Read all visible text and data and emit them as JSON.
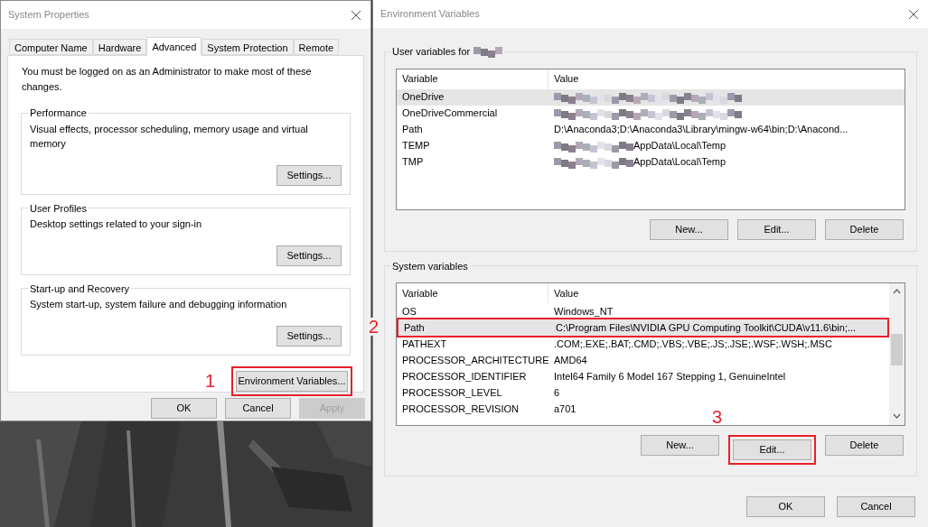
{
  "system_properties": {
    "title": "System Properties",
    "tabs": [
      {
        "label": "Computer Name",
        "selected": false
      },
      {
        "label": "Hardware",
        "selected": false
      },
      {
        "label": "Advanced",
        "selected": true
      },
      {
        "label": "System Protection",
        "selected": false
      },
      {
        "label": "Remote",
        "selected": false
      }
    ],
    "notice": "You must be logged on as an Administrator to make most of these changes.",
    "groups": [
      {
        "title": "Performance",
        "description": "Visual effects, processor scheduling, memory usage and virtual memory",
        "button": "Settings..."
      },
      {
        "title": "User Profiles",
        "description": "Desktop settings related to your sign-in",
        "button": "Settings..."
      },
      {
        "title": "Start-up and Recovery",
        "description": "System start-up, system failure and debugging information",
        "button": "Settings..."
      }
    ],
    "env_button": {
      "label": "Environment Variables...",
      "annotation": "1"
    },
    "buttons": [
      {
        "label": "OK",
        "disabled": false
      },
      {
        "label": "Cancel",
        "disabled": false
      },
      {
        "label": "Apply",
        "disabled": true
      }
    ]
  },
  "environment_variables": {
    "title": "Environment Variables",
    "user_group": {
      "title": "User variables for",
      "name_redacted": true,
      "columns": [
        "Variable",
        "Value"
      ],
      "rows": [
        {
          "variable": "OneDrive",
          "redacted": true,
          "selected": true
        },
        {
          "variable": "OneDriveCommercial",
          "redacted": true,
          "selected": false
        },
        {
          "variable": "Path",
          "value": "D:\\Anaconda3;D:\\Anaconda3\\Library\\mingw-w64\\bin;D:\\Anacond...",
          "redacted": false,
          "selected": false
        },
        {
          "variable": "TEMP",
          "value": "AppData\\Local\\Temp",
          "redacted": true,
          "selected": false
        },
        {
          "variable": "TMP",
          "value": "AppData\\Local\\Temp",
          "redacted": true,
          "selected": false
        }
      ],
      "buttons": [
        {
          "label": "New..."
        },
        {
          "label": "Edit..."
        },
        {
          "label": "Delete"
        }
      ]
    },
    "system_group": {
      "title": "System variables",
      "columns": [
        "Variable",
        "Value"
      ],
      "rows": [
        {
          "variable": "OS",
          "value": "Windows_NT",
          "selected": false
        },
        {
          "variable": "Path",
          "value": "C:\\Program Files\\NVIDIA GPU Computing Toolkit\\CUDA\\v11.6\\bin;...",
          "selected": true,
          "annotation": "2"
        },
        {
          "variable": "PATHEXT",
          "value": ".COM;.EXE;.BAT;.CMD;.VBS;.VBE;.JS;.JSE;.WSF;.WSH;.MSC",
          "selected": false
        },
        {
          "variable": "PROCESSOR_ARCHITECTURE",
          "value": "AMD64",
          "selected": false
        },
        {
          "variable": "PROCESSOR_IDENTIFIER",
          "value": "Intel64 Family 6 Model 167 Stepping 1, GenuineIntel",
          "selected": false
        },
        {
          "variable": "PROCESSOR_LEVEL",
          "value": "6",
          "selected": false
        },
        {
          "variable": "PROCESSOR_REVISION",
          "value": "a701",
          "selected": false
        }
      ],
      "buttons": [
        {
          "label": "New..."
        },
        {
          "label": "Edit...",
          "annotation": "3"
        },
        {
          "label": "Delete"
        }
      ]
    },
    "buttons": [
      {
        "label": "OK"
      },
      {
        "label": "Cancel"
      }
    ]
  }
}
